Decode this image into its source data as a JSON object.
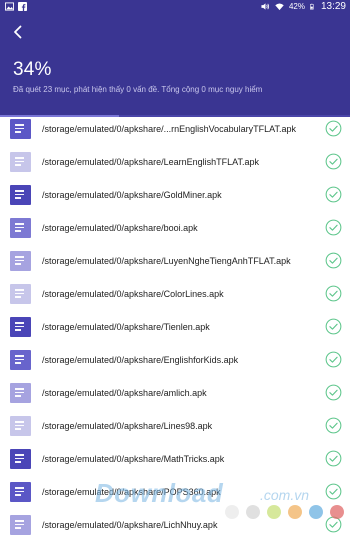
{
  "status_bar": {
    "battery_percent": "42%",
    "time": "13:29"
  },
  "header": {
    "progress": "34%",
    "progress_value": 0.34,
    "summary": "Đã quét 23 mục, phát hiện thấy 0 vấn đề. Tổng cộng 0 mục nguy hiểm"
  },
  "files": [
    {
      "path": "/storage/emulated/0/apkshare/...rnEnglishVocabularyTFLAT.apk",
      "icon_color": "#5b57c6"
    },
    {
      "path": "/storage/emulated/0/apkshare/LearnEnglishTFLAT.apk",
      "icon_color": "#c7c6ea"
    },
    {
      "path": "/storage/emulated/0/apkshare/GoldMiner.apk",
      "icon_color": "#4a45b7"
    },
    {
      "path": "/storage/emulated/0/apkshare/booi.apk",
      "icon_color": "#7d79d3"
    },
    {
      "path": "/storage/emulated/0/apkshare/LuyenNgheTiengAnhTFLAT.apk",
      "icon_color": "#a6a3e0"
    },
    {
      "path": "/storage/emulated/0/apkshare/ColorLines.apk",
      "icon_color": "#c7c6ea"
    },
    {
      "path": "/storage/emulated/0/apkshare/Tienlen.apk",
      "icon_color": "#4a45b7"
    },
    {
      "path": "/storage/emulated/0/apkshare/EnglishforKids.apk",
      "icon_color": "#6864cc"
    },
    {
      "path": "/storage/emulated/0/apkshare/amlich.apk",
      "icon_color": "#a6a3e0"
    },
    {
      "path": "/storage/emulated/0/apkshare/Lines98.apk",
      "icon_color": "#c7c6ea"
    },
    {
      "path": "/storage/emulated/0/apkshare/MathTricks.apk",
      "icon_color": "#4a45b7"
    },
    {
      "path": "/storage/emulated/0/apkshare/POPS360.apk",
      "icon_color": "#5b57c6"
    },
    {
      "path": "/storage/emulated/0/apkshare/LichNhuy.apk",
      "icon_color": "#a6a3e0"
    }
  ],
  "watermark": {
    "text": "Download",
    "suffix": ".com.vn",
    "dot_colors": [
      "#e8e8e8",
      "#d6d6d6",
      "#c8e07a",
      "#f0b060",
      "#6ab0e0",
      "#e06a6a"
    ]
  },
  "colors": {
    "header_bg": "#3a3592",
    "check_green": "#5cc58a"
  }
}
